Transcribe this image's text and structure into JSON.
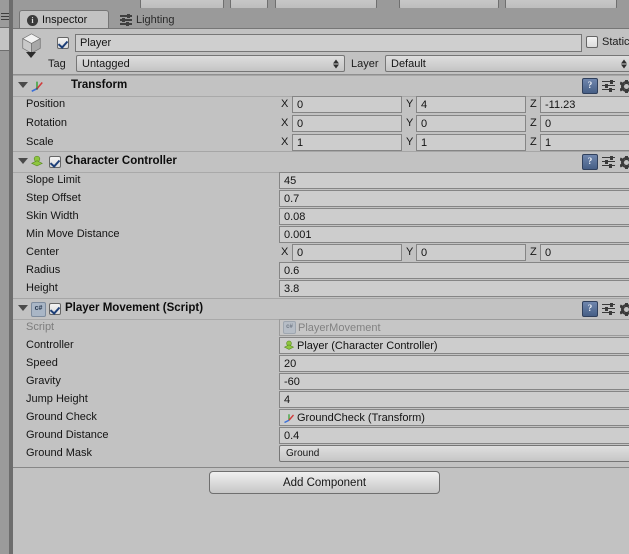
{
  "window": {
    "lock_icon": "lock-icon",
    "menu_icon": "panel-menu-icon"
  },
  "tabs": [
    {
      "label": "Inspector",
      "icon": "info-icon",
      "active": true
    },
    {
      "label": "Lighting",
      "icon": "lighting-icon",
      "active": false
    }
  ],
  "gameobject": {
    "icon": "gameobject-cube-icon",
    "enabled": true,
    "name": "Player",
    "static_label": "Static",
    "static_checked": false,
    "tag_label": "Tag",
    "tag_value": "Untagged",
    "layer_label": "Layer",
    "layer_value": "Default"
  },
  "components": [
    {
      "id": "transform",
      "title": "Transform",
      "icon": "transform-axis-icon",
      "has_checkbox": false,
      "enabled": true,
      "rows": [
        {
          "type": "vector3",
          "label": "Position",
          "x": "0",
          "y": "4",
          "z": "-11.23"
        },
        {
          "type": "vector3",
          "label": "Rotation",
          "x": "0",
          "y": "0",
          "z": "0"
        },
        {
          "type": "vector3",
          "label": "Scale",
          "x": "1",
          "y": "1",
          "z": "1"
        }
      ]
    },
    {
      "id": "character-controller",
      "title": "Character Controller",
      "icon": "character-controller-icon",
      "has_checkbox": true,
      "enabled": true,
      "rows": [
        {
          "type": "text",
          "label": "Slope Limit",
          "value": "45"
        },
        {
          "type": "text",
          "label": "Step Offset",
          "value": "0.7"
        },
        {
          "type": "text",
          "label": "Skin Width",
          "value": "0.08"
        },
        {
          "type": "text",
          "label": "Min Move Distance",
          "value": "0.001"
        },
        {
          "type": "vector3",
          "label": "Center",
          "x": "0",
          "y": "0",
          "z": "0"
        },
        {
          "type": "text",
          "label": "Radius",
          "value": "0.6"
        },
        {
          "type": "text",
          "label": "Height",
          "value": "3.8"
        }
      ]
    },
    {
      "id": "player-movement",
      "title": "Player Movement (Script)",
      "icon": "csharp-script-icon",
      "has_checkbox": true,
      "enabled": true,
      "rows": [
        {
          "type": "object",
          "label": "Script",
          "value": "PlayerMovement",
          "value_icon": "csharp-script-icon",
          "disabled": true
        },
        {
          "type": "object",
          "label": "Controller",
          "value": "Player (Character Controller)",
          "value_icon": "character-controller-icon",
          "disabled": false
        },
        {
          "type": "text",
          "label": "Speed",
          "value": "20"
        },
        {
          "type": "text",
          "label": "Gravity",
          "value": "-60"
        },
        {
          "type": "text",
          "label": "Jump Height",
          "value": "4"
        },
        {
          "type": "object",
          "label": "Ground Check",
          "value": "GroundCheck (Transform)",
          "value_icon": "transform-axis-icon",
          "disabled": false
        },
        {
          "type": "text",
          "label": "Ground Distance",
          "value": "0.4"
        },
        {
          "type": "mask",
          "label": "Ground Mask",
          "value": "Ground"
        }
      ]
    }
  ],
  "add_component": {
    "label": "Add Component"
  },
  "header_icons": {
    "help": "?",
    "help_name": "help-book-icon",
    "preset_name": "preset-icon",
    "gear_name": "gear-icon"
  },
  "colors": {
    "panel_bg": "#c2c2c2",
    "window_bg": "#9a9a9a",
    "field_bg": "#cdcdcd",
    "text": "#141414",
    "disabled_text": "#7d7d7d"
  }
}
